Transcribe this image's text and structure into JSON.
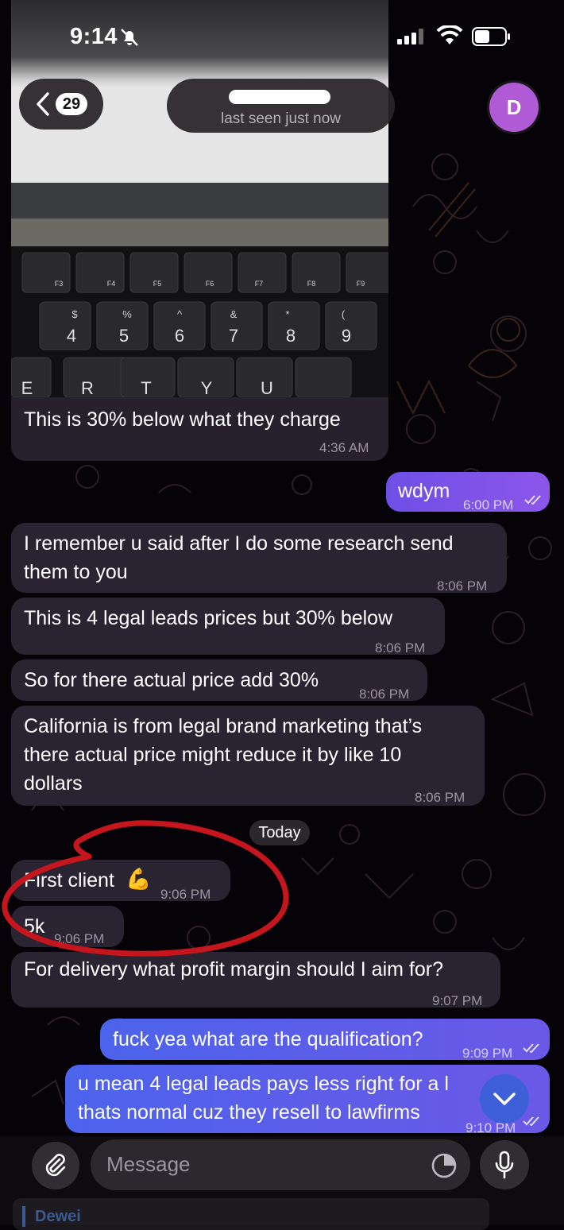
{
  "status_bar": {
    "time": "9:14"
  },
  "header": {
    "back_count": "29",
    "last_seen": "last seen just now",
    "avatar_letter": "D"
  },
  "photo_message": {
    "caption": "This is 30% below what they charge",
    "time": "4:36 AM",
    "keyboard_fn": [
      "F3",
      "F4",
      "F5",
      "F6",
      "F7",
      "F8",
      "F9"
    ],
    "keyboard_numbers": [
      "4",
      "5",
      "6",
      "7",
      "8",
      "9"
    ],
    "keyboard_symbols": [
      "$",
      "%",
      "^",
      "&",
      "*",
      "("
    ],
    "keyboard_letters": [
      "E",
      "R",
      "T",
      "Y",
      "U"
    ]
  },
  "messages": [
    {
      "id": "m1",
      "dir": "out",
      "text": "wdym",
      "time": "6:00 PM"
    },
    {
      "id": "m2",
      "dir": "in",
      "lines": [
        "I remember u said after I do some research send",
        "them to you"
      ],
      "time": "8:06 PM"
    },
    {
      "id": "m3",
      "dir": "in",
      "text": "This is 4 legal leads prices but 30% below",
      "time": "8:06 PM"
    },
    {
      "id": "m4",
      "dir": "in",
      "text": "So for there actual price add 30%",
      "time": "8:06 PM"
    },
    {
      "id": "m5",
      "dir": "in",
      "lines": [
        "California is from legal brand marketing that’s",
        "there actual price might reduce it by like 10",
        "dollars"
      ],
      "time": "8:06 PM"
    },
    {
      "id": "m6",
      "dir": "in",
      "text": "First client",
      "emoji": "💪",
      "time": "9:06 PM"
    },
    {
      "id": "m7",
      "dir": "in",
      "text": "5k",
      "time": "9:06 PM"
    },
    {
      "id": "m8",
      "dir": "in",
      "text": "For delivery what profit margin should I aim for?",
      "time": "9:07 PM"
    },
    {
      "id": "m9",
      "dir": "out",
      "text": "fuck yea what are the qualification?",
      "time": "9:09 PM"
    },
    {
      "id": "m10",
      "dir": "out",
      "lines": [
        "u mean 4 legal leads pays less right for a l",
        "thats normal cuz they resell to lawfirms"
      ],
      "time": "9:10 PM"
    }
  ],
  "date_separator": "Today",
  "composer": {
    "placeholder": "Message"
  },
  "below_preview": {
    "name": "Dewei"
  },
  "colors": {
    "accent": "#8d56ea",
    "outgoing_blue": "#4c63ec",
    "incoming": "#2a2331",
    "avatar": "#b05ad6",
    "annotation": "#c4161c"
  },
  "icons": [
    "chevron-left-icon",
    "attach-paperclip-icon",
    "sticker-clock-icon",
    "microphone-icon",
    "chevron-down-icon",
    "double-check-icon",
    "bell-slash-icon",
    "signal-icon",
    "wifi-icon",
    "battery-icon",
    "flexed-biceps-emoji"
  ]
}
